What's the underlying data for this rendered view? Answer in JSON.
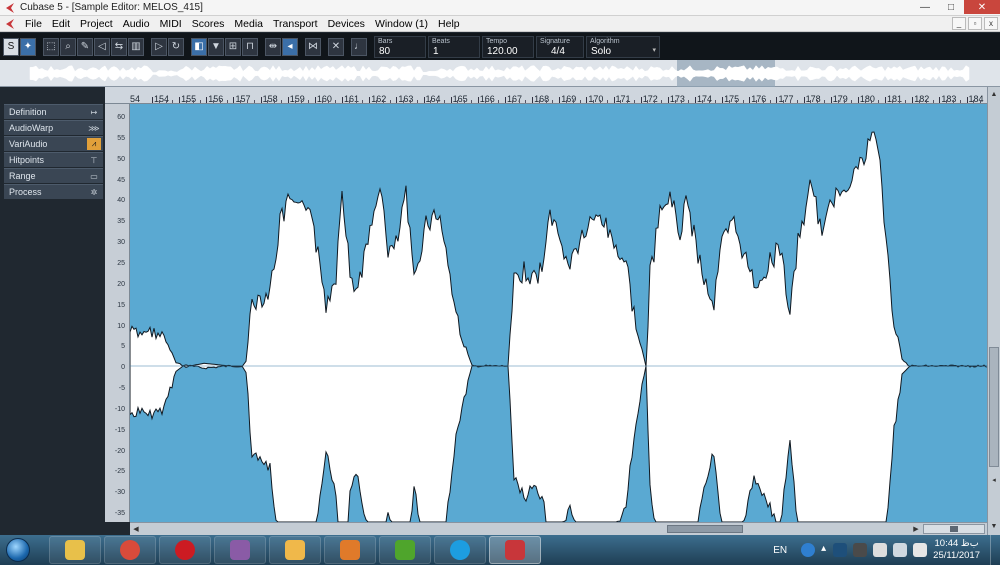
{
  "window": {
    "title": "Cubase 5 - [Sample Editor: MELOS_415]",
    "minimize": "—",
    "maximize": "□",
    "close": "✕"
  },
  "menu": [
    "File",
    "Edit",
    "Project",
    "Audio",
    "MIDI",
    "Scores",
    "Media",
    "Transport",
    "Devices",
    "Window (1)",
    "Help"
  ],
  "mdi_buttons": [
    "_",
    "▫",
    "x"
  ],
  "toolbar": {
    "solo_label": "S",
    "fields": [
      {
        "label": "Bars",
        "value": "80"
      },
      {
        "label": "Beats",
        "value": "1"
      },
      {
        "label": "Tempo",
        "value": "120.00"
      },
      {
        "label": "Signature",
        "value": "4/4"
      },
      {
        "label": "Algorithm",
        "value": "Solo"
      }
    ]
  },
  "inspector": [
    {
      "label": "Definition",
      "icon": "definition-icon",
      "glyph": "↦"
    },
    {
      "label": "AudioWarp",
      "icon": "audiowarp-icon",
      "glyph": "⋙"
    },
    {
      "label": "VariAudio",
      "icon": "variaudio-icon",
      "glyph": "⩘",
      "selected": true
    },
    {
      "label": "Hitpoints",
      "icon": "hitpoints-icon",
      "glyph": "⊤"
    },
    {
      "label": "Range",
      "icon": "range-icon",
      "glyph": "▭"
    },
    {
      "label": "Process",
      "icon": "process-icon",
      "glyph": "✲"
    }
  ],
  "ruler": {
    "bars": [
      "154",
      "155",
      "156",
      "157",
      "158",
      "159",
      "160",
      "161",
      "162",
      "163",
      "164",
      "165",
      "166",
      "167",
      "168",
      "169",
      "170",
      "171",
      "172",
      "173",
      "174",
      "175",
      "176",
      "177",
      "178",
      "179",
      "180",
      "181",
      "182",
      "183",
      "184",
      "185"
    ],
    "first_label": "54"
  },
  "amplitude_scale": [
    "60",
    "55",
    "50",
    "45",
    "40",
    "35",
    "30",
    "25",
    "20",
    "15",
    "10",
    "5",
    "0",
    "-5",
    "-10",
    "-15",
    "-20",
    "-25",
    "-30",
    "-35"
  ],
  "taskbar": {
    "apps": [
      {
        "name": "explorer",
        "color": "#e8c04a"
      },
      {
        "name": "chrome",
        "color": "#d94b3b"
      },
      {
        "name": "opera",
        "color": "#cc1b22"
      },
      {
        "name": "winrar",
        "color": "#8a5ba6"
      },
      {
        "name": "mail",
        "color": "#f0b84a"
      },
      {
        "name": "media-player",
        "color": "#e07a2a"
      },
      {
        "name": "utorrent",
        "color": "#4fa52c"
      },
      {
        "name": "skype",
        "color": "#1d9de0"
      },
      {
        "name": "cubase",
        "color": "#c8363a",
        "active": true
      }
    ],
    "lang": "EN",
    "time": "10:44 ﺏﻅ",
    "date": "25/11/2017"
  },
  "colors": {
    "waveform_bg": "#5aa9d2",
    "waveform_fill": "#ffffff"
  }
}
